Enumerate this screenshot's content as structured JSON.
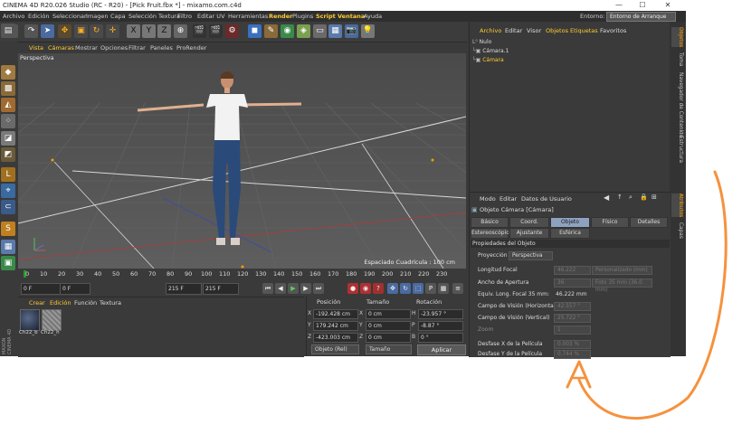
{
  "window": {
    "title": "CINEMA 4D R20.026 Studio (RC - R20) - [Pick Fruit.fbx *] - mixamo.com.c4d",
    "minimize": "—",
    "maximize": "☐",
    "close": "✕"
  },
  "menubar": {
    "items": [
      "Archivo",
      "Edición",
      "Seleccionar",
      "Imagen",
      "Capa",
      "Selección Textura",
      "Filtro",
      "Editar UV",
      "Herramientas",
      "Render",
      "Plugins",
      "Script",
      "Ventana",
      "Ayuda"
    ],
    "layout_label": "Entorno:",
    "layout_value": "Entorno de Arranque"
  },
  "viewport": {
    "menu": [
      "Vista",
      "Cámaras",
      "Mostrar",
      "Opciones",
      "Filtrar",
      "Paneles",
      "ProRender"
    ],
    "label": "Perspectiva",
    "grid_spacing": "Espaciado Cuadrícula : 100 cm"
  },
  "timeline": {
    "ticks": [
      "0",
      "10",
      "20",
      "30",
      "40",
      "50",
      "60",
      "70",
      "80",
      "90",
      "100",
      "110",
      "120",
      "130",
      "140",
      "150",
      "160",
      "170",
      "180",
      "190",
      "200",
      "210",
      "220",
      "230"
    ],
    "current_frame": "0 F",
    "start": "0 F",
    "end": "215 F",
    "end2": "215 F"
  },
  "material_manager": {
    "menu": [
      "Crear",
      "Edición",
      "Función",
      "Textura"
    ],
    "materials": [
      {
        "name": "Ch22_b"
      },
      {
        "name": "Ch22_h"
      }
    ]
  },
  "coordinates": {
    "headers": {
      "position": "Posición",
      "size": "Tamaño",
      "rotation": "Rotación"
    },
    "rows": [
      {
        "axis": "X",
        "position": "-192.428 cm",
        "size_axis": "X",
        "size": "0 cm",
        "rot_axis": "H",
        "rotation": "-23.957 °"
      },
      {
        "axis": "Y",
        "position": "179.242 cm",
        "size_axis": "Y",
        "size": "0 cm",
        "rot_axis": "P",
        "rotation": "-8.87 °"
      },
      {
        "axis": "Z",
        "position": "-423.003 cm",
        "size_axis": "Z",
        "size": "0 cm",
        "rot_axis": "B",
        "rotation": "0 °"
      }
    ],
    "mode_select": "Objeto (Rel)",
    "size_select": "Tamaño",
    "apply": "Aplicar"
  },
  "object_manager": {
    "menu": [
      "Archivo",
      "Editar",
      "Visor",
      "Objetos",
      "Etiquetas",
      "Favoritos"
    ],
    "objects": [
      {
        "name": "Nulo",
        "selected": false
      },
      {
        "name": "Cámara.1",
        "selected": false
      },
      {
        "name": "Cámara",
        "selected": true
      }
    ]
  },
  "right_tabs": {
    "top": [
      "Objetos",
      "Toma",
      "Navegador de Contenido",
      "Estructura"
    ],
    "bottom": [
      "Atributos",
      "Capas"
    ]
  },
  "attributes": {
    "menu": [
      "Modo",
      "Editar",
      "Datos de Usuario"
    ],
    "object_title": "Objeto Cámara [Cámara]",
    "tabs_row1": [
      "Básico",
      "Coord.",
      "Objeto",
      "Físico",
      "Detalles"
    ],
    "tabs_row2": [
      "Estereoscópico",
      "Ajustante",
      "Esférica"
    ],
    "active_tab": "Objeto",
    "section": "Propiedades del Objeto",
    "properties": [
      {
        "label": "Proyección",
        "value": "Perspectiva",
        "enabled": true
      },
      {
        "label": "Longitud Focal",
        "value": "46.222",
        "extra": "Personalizado (mm)",
        "enabled": true
      },
      {
        "label": "Ancho de Apertura",
        "value": "36",
        "extra": "Foto 35 mm (36.0 mm)",
        "enabled": true
      },
      {
        "label": "Equiv. Long. Focal 35 mm:",
        "value": "46.222 mm",
        "enabled": true
      },
      {
        "label": "Campo de Visión (Horizontal)",
        "value": "42.557 °",
        "enabled": true
      },
      {
        "label": "Campo de Visión (Vertical)",
        "value": "25.722 °",
        "enabled": true
      },
      {
        "label": "Zoom",
        "value": "1",
        "enabled": false
      },
      {
        "label": "Desfase X de la Película",
        "value": "0.003 %",
        "enabled": true
      },
      {
        "label": "Desfase Y de la Película",
        "value": "0.744 %",
        "enabled": true
      }
    ]
  },
  "colors": {
    "app_bg": "#3a3a3a",
    "viewport_bg": "#545454",
    "highlight": "#ffcc33",
    "active_tab": "#8ea2c0",
    "annotation_arrow": "#f5923e"
  }
}
